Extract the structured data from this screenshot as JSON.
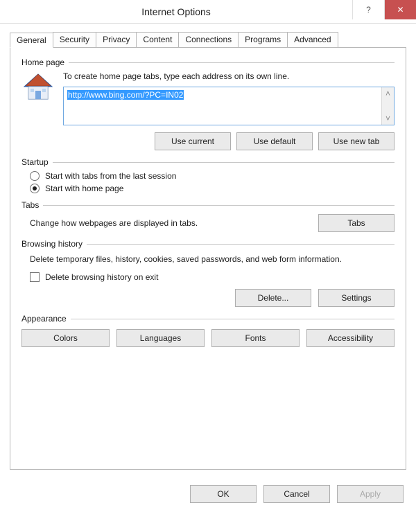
{
  "title": "Internet Options",
  "tabs": [
    "General",
    "Security",
    "Privacy",
    "Content",
    "Connections",
    "Programs",
    "Advanced"
  ],
  "activeTab": 0,
  "homepage": {
    "title": "Home page",
    "desc": "To create home page tabs, type each address on its own line.",
    "url": "http://www.bing.com/?PC=IN02",
    "useCurrent": "Use current",
    "useDefault": "Use default",
    "useNewTab": "Use new tab"
  },
  "startup": {
    "title": "Startup",
    "opt1": "Start with tabs from the last session",
    "opt2": "Start with home page",
    "selected": 1
  },
  "tabsSection": {
    "title": "Tabs",
    "desc": "Change how webpages are displayed in tabs.",
    "button": "Tabs"
  },
  "history": {
    "title": "Browsing history",
    "desc": "Delete temporary files, history, cookies, saved passwords, and web form information.",
    "checkbox": "Delete browsing history on exit",
    "delete": "Delete...",
    "settings": "Settings"
  },
  "appearance": {
    "title": "Appearance",
    "colors": "Colors",
    "languages": "Languages",
    "fonts": "Fonts",
    "accessibility": "Accessibility"
  },
  "footer": {
    "ok": "OK",
    "cancel": "Cancel",
    "apply": "Apply"
  }
}
